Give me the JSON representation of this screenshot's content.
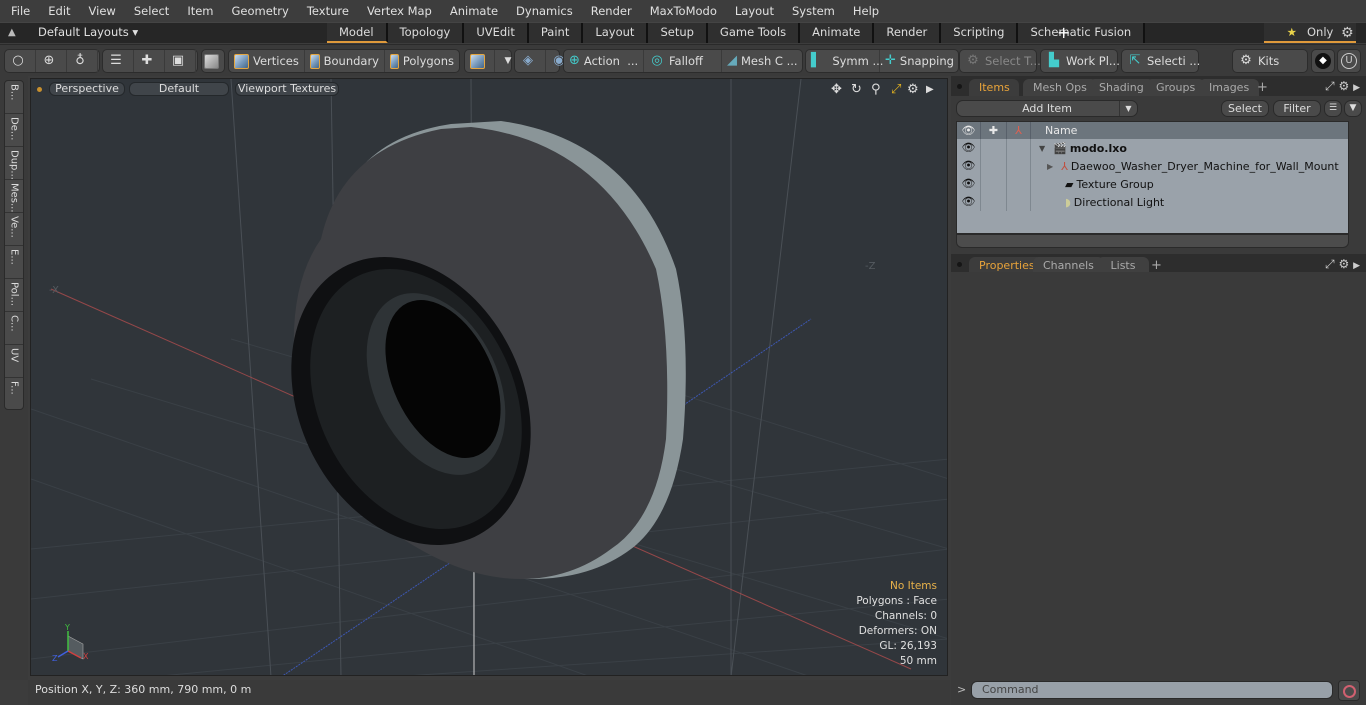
{
  "menu": [
    "File",
    "Edit",
    "View",
    "Select",
    "Item",
    "Geometry",
    "Texture",
    "Vertex Map",
    "Animate",
    "Dynamics",
    "Render",
    "MaxToModo",
    "Layout",
    "System",
    "Help"
  ],
  "layout": {
    "dropdown": "Default Layouts ▾",
    "tabs": [
      "Model",
      "Topology",
      "UVEdit",
      "Paint",
      "Layout",
      "Setup",
      "Game Tools",
      "Animate",
      "Render",
      "Scripting",
      "Schematic Fusion"
    ],
    "active_tab": "Model",
    "only_label": "Only"
  },
  "toolbar": {
    "vertices": "Vertices",
    "boundary": "Boundary",
    "polygons": "Polygons",
    "action": "Action",
    "action_more": "...",
    "falloff": "Falloff",
    "mesh": "Mesh C ...",
    "symmetry": "Symm ...",
    "snapping": "Snapping",
    "select_t": "Select T...",
    "work_plane": "Work Pl...",
    "selection": "Selecti ...",
    "kits": "Kits"
  },
  "left_tabs": [
    "B...",
    "De...",
    "Dup...",
    "Mes...",
    "Ve...",
    "E...",
    "Pol...",
    "C...",
    "UV",
    "F..."
  ],
  "viewport": {
    "view": "Perspective",
    "shading": "Default",
    "textures": "Viewport Textures",
    "axis_x": "-X",
    "axis_z": "-Z",
    "info": {
      "selection": "No Items",
      "polygons": "Polygons : Face",
      "channels": "Channels: 0",
      "deformers": "Deformers: ON",
      "gl": "GL: 26,193",
      "scale": "50 mm"
    },
    "gizmo": {
      "y": "Y",
      "z": "Z",
      "x": "X"
    }
  },
  "items_panel": {
    "tabs": [
      "Items",
      "Mesh Ops",
      "Shading",
      "Groups",
      "Images"
    ],
    "active_tab": "Items",
    "add_item": "Add Item",
    "select": "Select",
    "filter": "Filter",
    "column_name": "Name",
    "rows": [
      {
        "name": "modo.lxo",
        "icon": "scene-icon",
        "bold": true
      },
      {
        "name": "Daewoo_Washer_Dryer_Machine_for_Wall_Mount",
        "icon": "mesh-locator-icon"
      },
      {
        "name": "Texture Group",
        "icon": "texture-group-icon"
      },
      {
        "name": "Directional Light",
        "icon": "light-icon"
      }
    ]
  },
  "properties_panel": {
    "tabs": [
      "Properties",
      "Channels",
      "Lists"
    ],
    "active_tab": "Properties"
  },
  "status": {
    "position": "Position X, Y, Z:   360 mm, 790 mm, 0 m"
  },
  "command": {
    "prompt": ">",
    "placeholder": "Command"
  },
  "colors": {
    "accent": "#e09a3b",
    "axis_x": "#d04040",
    "axis_y": "#40c040",
    "axis_z": "#4060e0"
  }
}
